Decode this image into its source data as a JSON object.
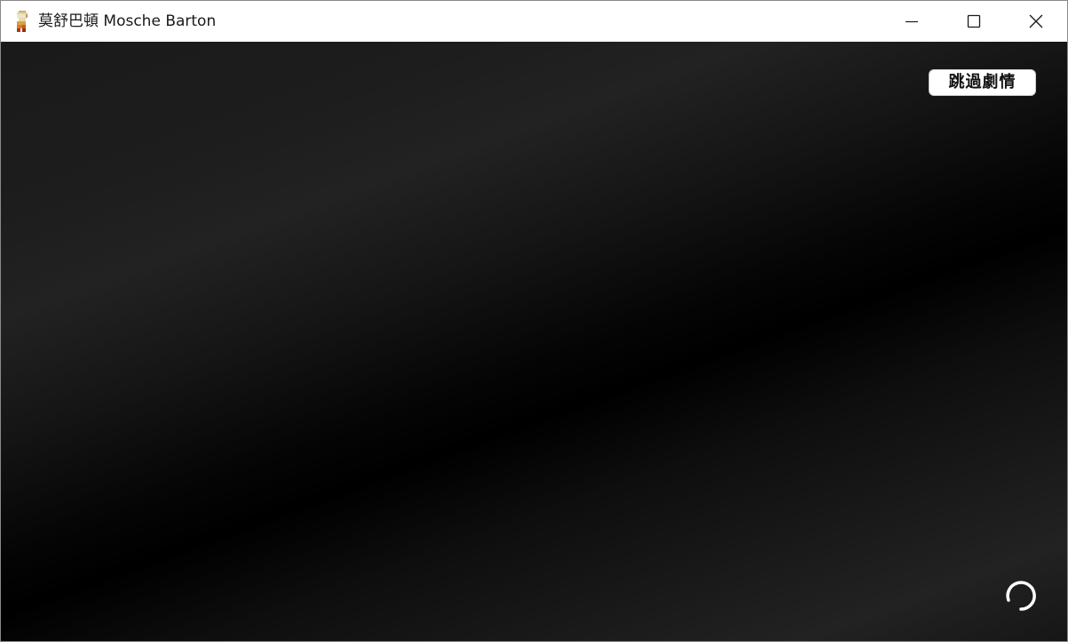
{
  "window": {
    "title": "莫舒巴頓 Mosche Barton",
    "app_icon": "pixel-character-icon",
    "controls": {
      "minimize_icon": "minimize-icon",
      "maximize_icon": "maximize-icon",
      "close_icon": "close-icon"
    }
  },
  "game": {
    "skip_button_label": "跳過劇情",
    "loading_icon": "loading-spinner-icon"
  },
  "colors": {
    "titlebar_bg": "#ffffff",
    "game_bg": "#000000",
    "button_bg": "#ffffff",
    "spinner": "#ffffff"
  }
}
